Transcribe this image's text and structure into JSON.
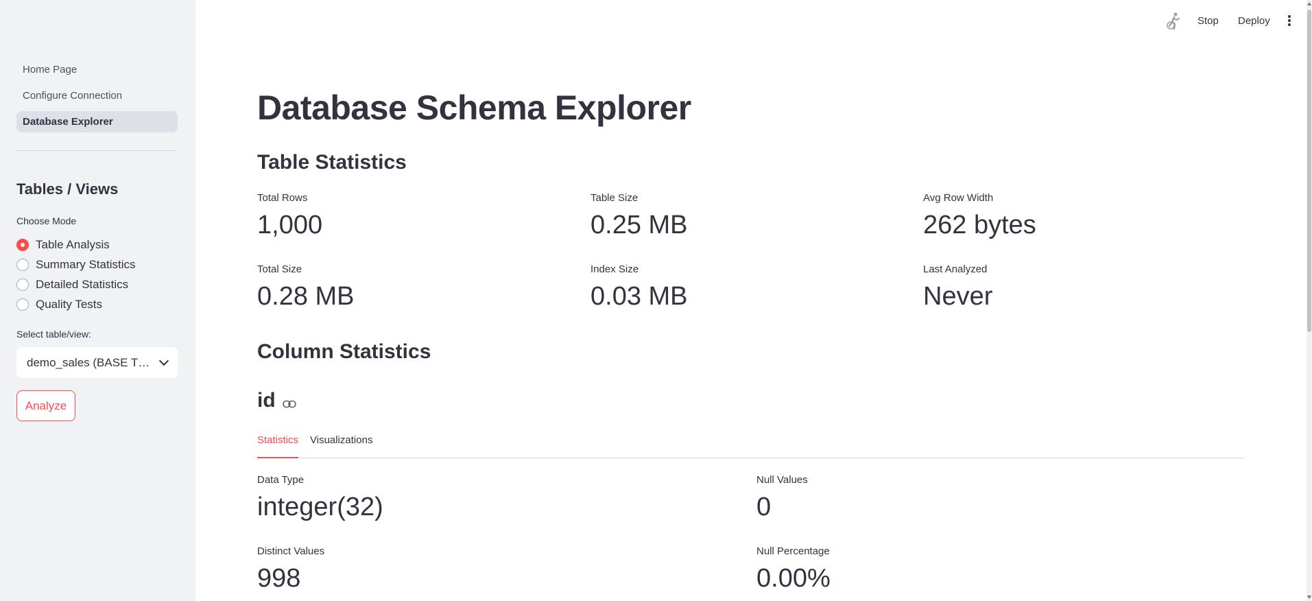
{
  "sidebar": {
    "nav": [
      {
        "label": "Home Page"
      },
      {
        "label": "Configure Connection"
      },
      {
        "label": "Database Explorer"
      }
    ],
    "section_title": "Tables / Views",
    "mode_label": "Choose Mode",
    "modes": [
      {
        "label": "Table Analysis",
        "selected": true
      },
      {
        "label": "Summary Statistics",
        "selected": false
      },
      {
        "label": "Detailed Statistics",
        "selected": false
      },
      {
        "label": "Quality Tests",
        "selected": false
      }
    ],
    "select_label": "Select table/view:",
    "select_value": "demo_sales (BASE T…",
    "analyze_label": "Analyze"
  },
  "header": {
    "stop_label": "Stop",
    "deploy_label": "Deploy"
  },
  "main": {
    "title": "Database Schema Explorer",
    "table_stats_title": "Table Statistics",
    "table_stats": [
      {
        "label": "Total Rows",
        "value": "1,000"
      },
      {
        "label": "Table Size",
        "value": "0.25 MB"
      },
      {
        "label": "Avg Row Width",
        "value": "262 bytes"
      },
      {
        "label": "Total Size",
        "value": "0.28 MB"
      },
      {
        "label": "Index Size",
        "value": "0.03 MB"
      },
      {
        "label": "Last Analyzed",
        "value": "Never"
      }
    ],
    "column_stats_title": "Column Statistics",
    "column_name": "id",
    "tabs": [
      {
        "label": "Statistics",
        "active": true
      },
      {
        "label": "Visualizations",
        "active": false
      }
    ],
    "column_stats": [
      {
        "label": "Data Type",
        "value": "integer(32)"
      },
      {
        "label": "Null Values",
        "value": "0"
      },
      {
        "label": "Distinct Values",
        "value": "998"
      },
      {
        "label": "Null Percentage",
        "value": "0.00%"
      }
    ]
  },
  "colors": {
    "accent": "#ff4b4b",
    "sidebar_bg": "#f0f2f6",
    "text": "#31333f"
  }
}
